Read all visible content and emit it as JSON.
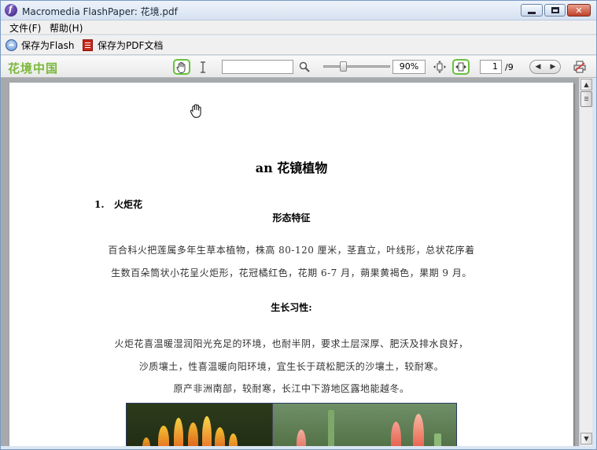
{
  "window": {
    "title": "Macromedia FlashPaper: 花境.pdf",
    "controls": {
      "minimize": "",
      "maximize": "",
      "close": "✕"
    }
  },
  "menu": {
    "items": [
      "文件(F)",
      "帮助(H)"
    ]
  },
  "save_toolbar": {
    "save_flash": "保存为Flash",
    "save_pdf": "保存为PDF文档"
  },
  "viewer_toolbar": {
    "logo": "花境中国",
    "search_value": "",
    "zoom": "90%",
    "zoom_level_fraction": 0.3,
    "page_current": "1",
    "page_total": "/9",
    "icons": [
      "hand-tool-icon",
      "text-select-icon",
      "search-icon",
      "fit-page-icon",
      "fit-width-icon",
      "prev-page-icon",
      "next-page-icon",
      "print-icon"
    ]
  },
  "document": {
    "title": "an 花镜植物",
    "section": "1.   火炬花",
    "subhead_1": "形态特征",
    "line_1": "百合科火把莲属多年生草本植物，株高 80-120 厘米，茎直立，叶线形，总状花序着",
    "line_2": "生数百朵筒状小花呈火炬形，花冠橘红色，花期 6-7 月，蒴果黄褐色，果期 9 月。",
    "subhead_2": "生长习性:",
    "line_3": "火炬花喜温暖湿润阳光充足的环境，也耐半阴，要求土层深厚、肥沃及排水良好，",
    "line_4": "沙质壤土，性喜温暖向阳环境，宜生长于疏松肥沃的沙壤土，较耐寒。",
    "line_5": "原产非洲南部，较耐寒，长江中下游地区露地能越冬。"
  },
  "colors": {
    "logo_green": "#7bb83a",
    "active_tool_border": "#67c13c",
    "doc_background": "#a7aaad"
  }
}
